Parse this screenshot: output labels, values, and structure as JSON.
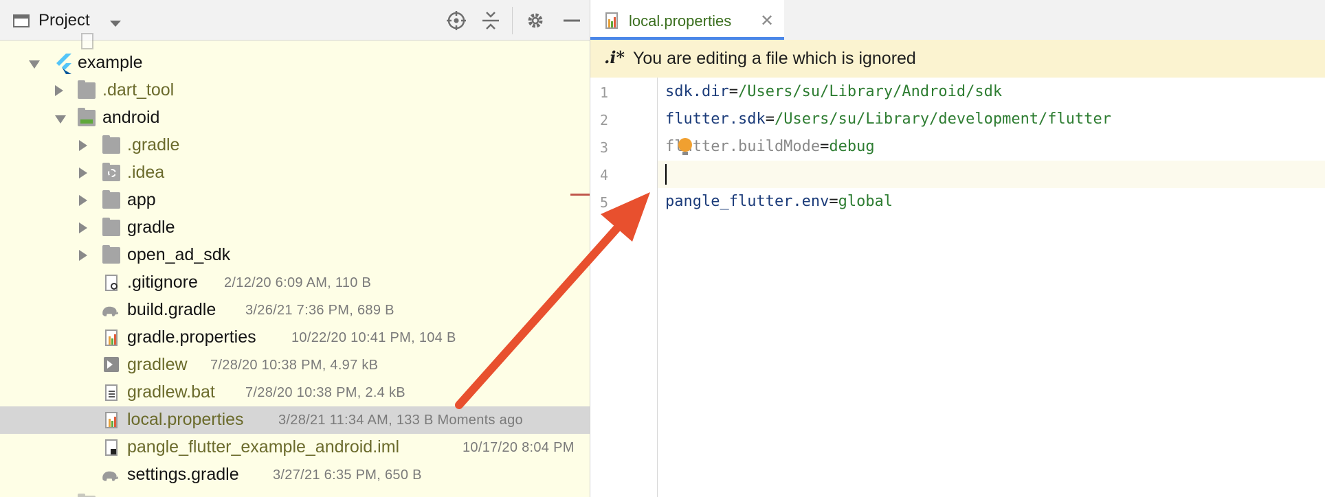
{
  "project_panel": {
    "title": "Project",
    "icons": [
      "window-icon",
      "dropdown-chevron-icon",
      "locate-icon",
      "collapse-all-icon",
      "gear-icon",
      "hide-icon"
    ],
    "tree": [
      {
        "name": "example",
        "type": "flutter-module",
        "expanded": true
      },
      {
        "name": ".dart_tool",
        "type": "folder",
        "expanded": false
      },
      {
        "name": "android",
        "type": "android-folder",
        "expanded": true
      },
      {
        "name": ".gradle",
        "type": "folder",
        "expanded": false
      },
      {
        "name": ".idea",
        "type": "idea-folder",
        "expanded": false
      },
      {
        "name": "app",
        "type": "folder",
        "expanded": false
      },
      {
        "name": "gradle",
        "type": "folder",
        "expanded": false
      },
      {
        "name": "open_ad_sdk",
        "type": "folder",
        "expanded": false
      },
      {
        "name": ".gitignore",
        "meta": "2/12/20 6:09 AM, 110 B"
      },
      {
        "name": "build.gradle",
        "meta": "3/26/21 7:36 PM, 689 B"
      },
      {
        "name": "gradle.properties",
        "meta": "10/22/20 10:41 PM, 104 B"
      },
      {
        "name": "gradlew",
        "meta": "7/28/20 10:38 PM, 4.97 kB"
      },
      {
        "name": "gradlew.bat",
        "meta": "7/28/20 10:38 PM, 2.4 kB"
      },
      {
        "name": "local.properties",
        "meta": "3/28/21 11:34 AM, 133 B Moments ago",
        "selected": true
      },
      {
        "name": "pangle_flutter_example_android.iml",
        "meta": "10/17/20 8:04 PM"
      },
      {
        "name": "settings.gradle",
        "meta": "3/27/21 6:35 PM, 650 B"
      }
    ]
  },
  "editor": {
    "tab_label": "local.properties",
    "banner_icon": ".i*",
    "banner_message": "You are editing a file which is ignored",
    "lines": [
      {
        "num": "1",
        "key": "sdk.dir",
        "eq": "=",
        "value": "/Users/su/Library/Android/sdk"
      },
      {
        "num": "2",
        "key": "flutter.sdk",
        "eq": "=",
        "value": "/Users/su/Library/development/flutter"
      },
      {
        "num": "3",
        "key": "flutter.buildMode",
        "eq": "=",
        "value": "debug"
      },
      {
        "num": "4",
        "key": "",
        "eq": "",
        "value": ""
      },
      {
        "num": "5",
        "key": "pangle_flutter.env",
        "eq": "=",
        "value": "global"
      }
    ]
  },
  "colors": {
    "project_bg": "#fefee6",
    "selected_row": "#d6d6d6",
    "banner_bg": "#fbf3d0",
    "tab_underline": "#4a86e8",
    "annotation_arrow": "#e8502e"
  }
}
